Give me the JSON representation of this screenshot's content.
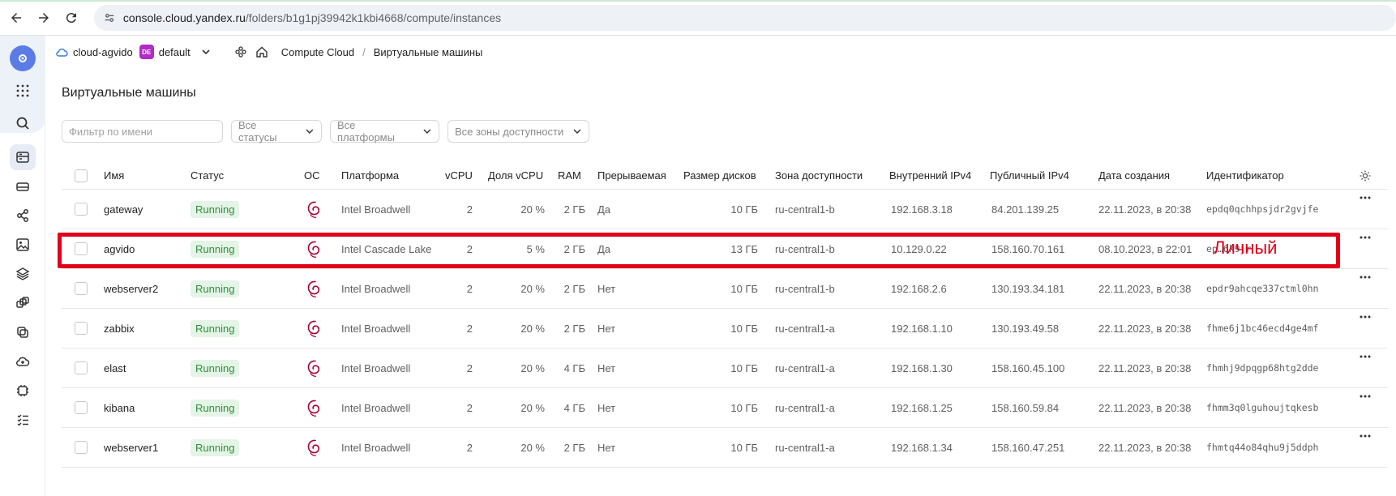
{
  "browser": {
    "url_host": "console.cloud.yandex.ru",
    "url_path": "/folders/b1g1pj39942k1kbi4668/compute/instances"
  },
  "header": {
    "cloud_name": "cloud-agvido",
    "folder_badge": "DE",
    "folder_name": "default",
    "breadcrumbs": [
      "Compute Cloud",
      "Виртуальные машины"
    ],
    "breadcrumb_separator": "/"
  },
  "page": {
    "title": "Виртуальные машины"
  },
  "filters": {
    "name_placeholder": "Фильтр по имени",
    "status": "Все статусы",
    "platform": "Все платформы",
    "zone": "Все зоны доступности"
  },
  "table": {
    "columns": [
      "Имя",
      "Статус",
      "ОС",
      "Платформа",
      "vCPU",
      "Доля vCPU",
      "RAM",
      "Прерываемая",
      "Размер дисков",
      "Зона доступности",
      "Внутренний IPv4",
      "Публичный IPv4",
      "Дата создания",
      "Идентификатор"
    ],
    "rows": [
      {
        "name": "gateway",
        "status": "Running",
        "platform": "Intel Broadwell",
        "vcpu": "2",
        "share": "20 %",
        "ram": "2 ГБ",
        "preemptible": "Да",
        "disk": "10 ГБ",
        "zone": "ru-central1-b",
        "ip_int": "192.168.3.18",
        "ip_pub": "84.201.139.25",
        "created": "22.11.2023, в 20:38",
        "id": "epdq0qchhpsjdr2gvjfe"
      },
      {
        "name": "agvido",
        "status": "Running",
        "platform": "Intel Cascade Lake",
        "vcpu": "2",
        "share": "5 %",
        "ram": "2 ГБ",
        "preemptible": "Да",
        "disk": "13 ГБ",
        "zone": "ru-central1-b",
        "ip_int": "10.129.0.22",
        "ip_pub": "158.160.70.161",
        "created": "08.10.2023, в 22:01",
        "id": "ep…6k9jr"
      },
      {
        "name": "webserver2",
        "status": "Running",
        "platform": "Intel Broadwell",
        "vcpu": "2",
        "share": "20 %",
        "ram": "2 ГБ",
        "preemptible": "Нет",
        "disk": "10 ГБ",
        "zone": "ru-central1-b",
        "ip_int": "192.168.2.6",
        "ip_pub": "130.193.34.181",
        "created": "22.11.2023, в 20:38",
        "id": "epdr9ahcqe337ctml0hn"
      },
      {
        "name": "zabbix",
        "status": "Running",
        "platform": "Intel Broadwell",
        "vcpu": "2",
        "share": "20 %",
        "ram": "2 ГБ",
        "preemptible": "Нет",
        "disk": "10 ГБ",
        "zone": "ru-central1-a",
        "ip_int": "192.168.1.10",
        "ip_pub": "130.193.49.58",
        "created": "22.11.2023, в 20:38",
        "id": "fhme6j1bc46ecd4ge4mf"
      },
      {
        "name": "elast",
        "status": "Running",
        "platform": "Intel Broadwell",
        "vcpu": "2",
        "share": "20 %",
        "ram": "4 ГБ",
        "preemptible": "Нет",
        "disk": "10 ГБ",
        "zone": "ru-central1-a",
        "ip_int": "192.168.1.30",
        "ip_pub": "158.160.45.100",
        "created": "22.11.2023, в 20:38",
        "id": "fhmhj9dpqgp68htg2dde"
      },
      {
        "name": "kibana",
        "status": "Running",
        "platform": "Intel Broadwell",
        "vcpu": "2",
        "share": "20 %",
        "ram": "4 ГБ",
        "preemptible": "Нет",
        "disk": "10 ГБ",
        "zone": "ru-central1-a",
        "ip_int": "192.168.1.25",
        "ip_pub": "158.160.59.84",
        "created": "22.11.2023, в 20:38",
        "id": "fhmm3q0lguhoujtqkesb"
      },
      {
        "name": "webserver1",
        "status": "Running",
        "platform": "Intel Broadwell",
        "vcpu": "2",
        "share": "20 %",
        "ram": "2 ГБ",
        "preemptible": "Нет",
        "disk": "10 ГБ",
        "zone": "ru-central1-a",
        "ip_int": "192.168.1.34",
        "ip_pub": "158.160.47.251",
        "created": "22.11.2023, в 20:38",
        "id": "fhmtq44o84qhu9j5ddph"
      }
    ]
  },
  "annotation": {
    "label": "Личный",
    "color": "#e0001a"
  },
  "colors": {
    "status_running_bg": "#e4f4e6",
    "status_running_text": "#2f8f3e",
    "debian_red": "#a80030",
    "folder_badge": "#b22ac7"
  }
}
